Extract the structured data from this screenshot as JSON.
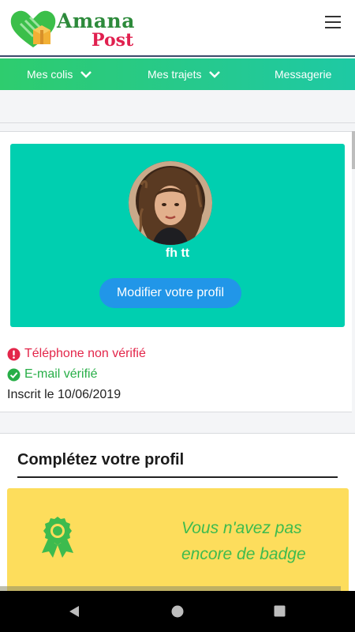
{
  "app": {
    "logo_line1": "Amana",
    "logo_line2": "Post"
  },
  "nav": {
    "items": [
      {
        "label": "Mes colis",
        "has_dropdown": true
      },
      {
        "label": "Mes trajets",
        "has_dropdown": true
      },
      {
        "label": "Messagerie",
        "has_dropdown": false
      }
    ]
  },
  "profile": {
    "name": "fh tt",
    "edit_label": "Modifier votre profil",
    "phone_status": "Téléphone non vérifié",
    "email_status": "E-mail vérifié",
    "registered": "Inscrit le 10/06/2019"
  },
  "complete": {
    "title": "Complétez votre profil",
    "badge_message": "Vous n'avez pas encore de badge"
  },
  "colors": {
    "nav_gradient_start": "#2ecc6e",
    "nav_gradient_end": "#1ec9a4",
    "profile_card": "#00cfb0",
    "edit_button": "#2196e8",
    "unverified": "#e3264a",
    "verified": "#27ae47",
    "badge_card": "#fddd5c",
    "badge_text": "#3dbb4e"
  },
  "icons": {
    "menu": "hamburger-icon",
    "dropdown": "chevron-down-icon",
    "phone_status": "exclamation-circle-icon",
    "email_status": "check-circle-icon",
    "badge": "award-ribbon-icon",
    "system_back": "back-triangle-icon",
    "system_home": "home-circle-icon",
    "system_recents": "recents-square-icon"
  }
}
